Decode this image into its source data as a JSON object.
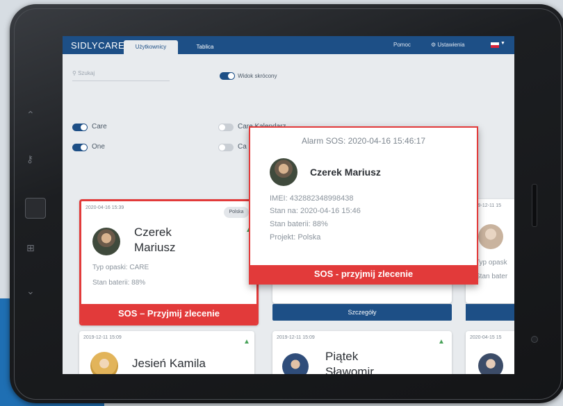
{
  "app": {
    "logo": "SIDLYCARE"
  },
  "tabs": [
    {
      "label": "Użytkownicy",
      "active": true
    },
    {
      "label": "Tablica",
      "active": false
    }
  ],
  "header": {
    "help_label": "Pomoc",
    "settings_label": "Ustawienia",
    "settings_icon": "gear-icon",
    "language_flag": "flag-icon"
  },
  "search": {
    "placeholder": "Szukaj"
  },
  "view_toggle": {
    "label": "Widok skrócony",
    "on": true
  },
  "filters": [
    {
      "label": "Care",
      "on": true
    },
    {
      "label": "One",
      "on": true
    },
    {
      "label": "Care Kalendarz",
      "on": false
    },
    {
      "label": "Ca",
      "on": false
    }
  ],
  "cards": [
    {
      "date": "2020-04-16 15:39",
      "badge": "Polska",
      "name_first": "Czerek",
      "name_last": "Mariusz",
      "band_type": "Typ opaski: CARE",
      "battery": "Stan baterii: 88%",
      "sos_label": "SOS – Przyjmij zlecenie"
    },
    {
      "details_label": "Szczegóły"
    },
    {
      "date": "2019-12-11 15",
      "band_type": "Typ opask",
      "battery": "Stan bater"
    },
    {
      "date": "2019-12-11 15:09",
      "name": "Jesień Kamila"
    },
    {
      "date": "2019-12-11 15:09",
      "name_first": "Piątek",
      "name_last": "Sławomir"
    },
    {
      "date": "2020-04-15 15"
    }
  ],
  "modal": {
    "title": "Alarm SOS: 2020-04-16 15:46:17",
    "name": "Czerek Mariusz",
    "imei": "IMEI: 432882348998438",
    "status_at": "Stan na: 2020-04-16 15:46",
    "battery": "Stan baterii: 88%",
    "project": "Projekt: Polska",
    "button_label": "SOS - przyjmij zlecenie"
  },
  "colors": {
    "brand": "#1d4f86",
    "alert": "#e23a3a",
    "signal": "#48a259"
  }
}
